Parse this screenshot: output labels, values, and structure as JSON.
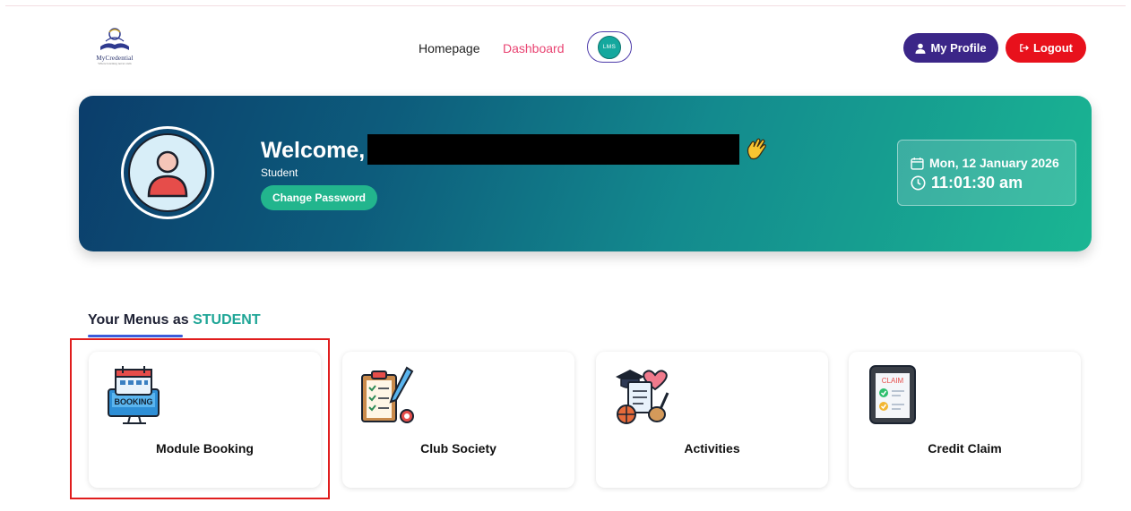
{
  "brand": {
    "name": "MyCredential",
    "tagline": "Where learning never ends"
  },
  "nav": {
    "home": "Homepage",
    "dashboard": "Dashboard",
    "lms": "LMS"
  },
  "actions": {
    "profile": "My Profile",
    "logout": "Logout"
  },
  "hero": {
    "welcome": "Welcome,",
    "role": "Student",
    "change_password": "Change Password",
    "date": "Mon, 12 January 2026",
    "time": "11:01:30 am"
  },
  "menus": {
    "title_prefix": "Your Menus as",
    "role": "STUDENT",
    "items": [
      {
        "label": "Module Booking",
        "icon": "booking-calendar-icon"
      },
      {
        "label": "Club Society",
        "icon": "clipboard-checklist-icon"
      },
      {
        "label": "Activities",
        "icon": "activities-icon"
      },
      {
        "label": "Credit Claim",
        "icon": "claim-tablet-icon"
      }
    ]
  },
  "colors": {
    "profile_btn": "#3b2688",
    "logout_btn": "#e8111c",
    "dashboard_link": "#e94472",
    "accent_teal": "#1ea596",
    "highlight": "#e01d1d"
  }
}
